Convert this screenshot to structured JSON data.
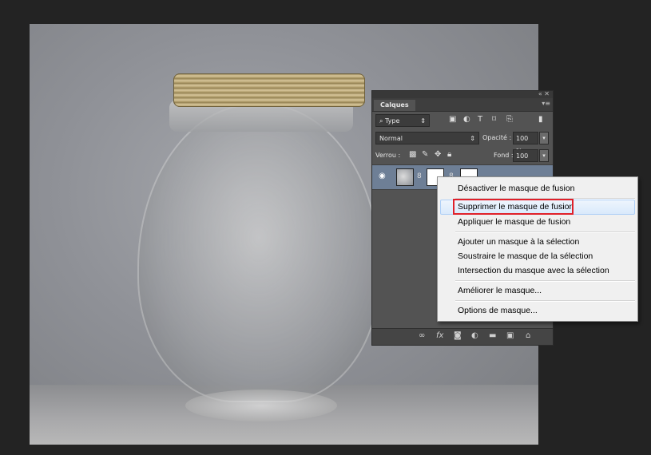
{
  "panel": {
    "tab_label": "Calques",
    "collapse_label": "«",
    "close_label": "✕",
    "filter_value": "Type",
    "blend_mode": "Normal",
    "opacity_label": "Opacité :",
    "opacity_value": "100 %",
    "lock_label": "Verrou :",
    "fill_label": "Fond :",
    "fill_value": "100 %"
  },
  "context_menu": {
    "items": [
      "Désactiver le masque de fusion",
      "Supprimer le masque de fusion",
      "Appliquer le masque de fusion",
      "Ajouter un masque à la sélection",
      "Soustraire le masque de la sélection",
      "Intersection du masque avec la sélection",
      "Améliorer le masque...",
      "Options de masque..."
    ],
    "highlighted_index": 1,
    "highlight_color": "#e0202a"
  },
  "icons": {
    "footer": [
      "link-icon",
      "fx-icon",
      "add-mask-icon",
      "adjustment-icon",
      "folder-icon",
      "new-layer-icon",
      "trash-icon"
    ]
  }
}
